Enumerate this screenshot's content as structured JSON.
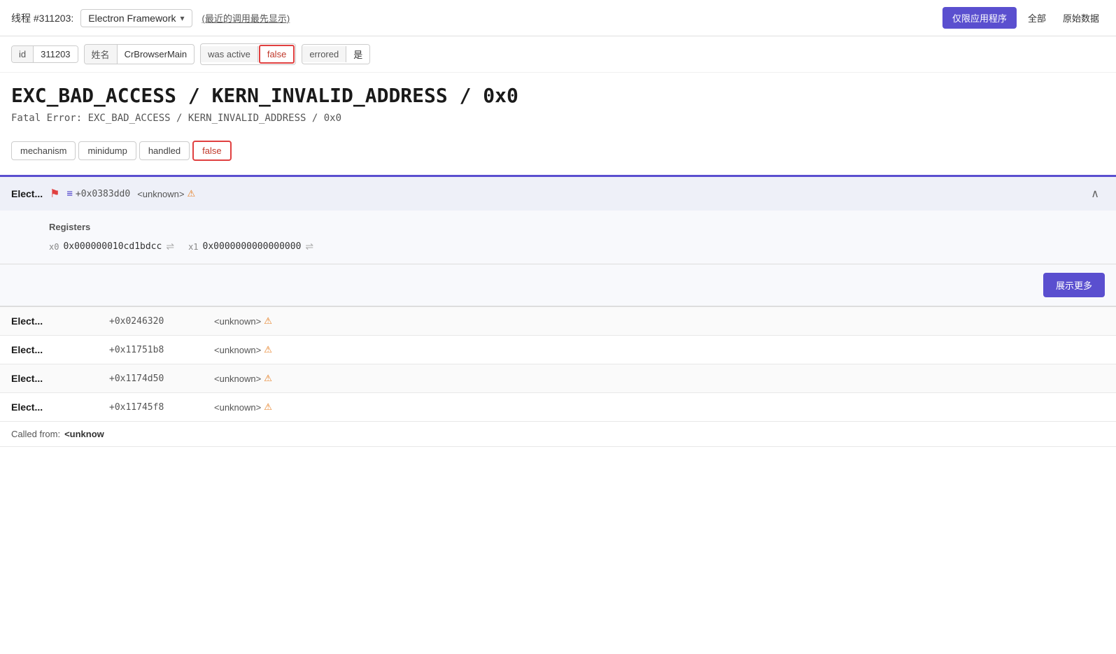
{
  "topbar": {
    "thread_label": "线程 #311203:",
    "thread_name": "Electron Framework",
    "dropdown_arrow": "▾",
    "recent_label": "(最近的调用最先显示)",
    "btn_app_only": "仅限应用程序",
    "btn_all": "全部",
    "btn_raw": "原始数据"
  },
  "info_badges": [
    {
      "key": "id",
      "val": "311203",
      "highlight": false
    },
    {
      "key": "姓名",
      "val": "CrBrowserMain",
      "highlight": false
    },
    {
      "key": "was active",
      "val": "false",
      "highlight": true
    },
    {
      "key": "errored",
      "val": "是",
      "highlight": false
    }
  ],
  "error": {
    "title": "EXC_BAD_ACCESS / KERN_INVALID_ADDRESS / 0x0",
    "subtitle": "Fatal Error: EXC_BAD_ACCESS / KERN_INVALID_ADDRESS / 0x0"
  },
  "tags": [
    {
      "label": "mechanism",
      "highlight": false
    },
    {
      "label": "minidump",
      "highlight": false
    },
    {
      "label": "handled",
      "highlight": false
    },
    {
      "label": "false",
      "highlight": true
    }
  ],
  "active_frame": {
    "name": "Elect...",
    "flag": "⚑",
    "lines_icon": "≡",
    "offset": "+0x0383dd0",
    "location": "<unknown>",
    "warn_icon": "⚠",
    "collapse_icon": "∧"
  },
  "registers": {
    "title": "Registers",
    "items": [
      {
        "name": "x0",
        "value": "0x000000010cd1bdcc"
      },
      {
        "name": "x1",
        "value": "0x0000000000000000"
      }
    ],
    "settings_icon": "⇌",
    "show_more_btn": "展示更多"
  },
  "frames": [
    {
      "name": "Elect...",
      "offset": "+0x0246320",
      "location": "<unknown>",
      "warn": true
    },
    {
      "name": "Elect...",
      "offset": "+0x11751b8",
      "location": "<unknown>",
      "warn": true
    },
    {
      "name": "Elect...",
      "offset": "+0x1174d50",
      "location": "<unknown>",
      "warn": true
    },
    {
      "name": "Elect...",
      "offset": "+0x11745f8",
      "location": "<unknown>",
      "warn": true
    }
  ],
  "called_from": {
    "label": "Called from:",
    "value": "<unknow"
  }
}
